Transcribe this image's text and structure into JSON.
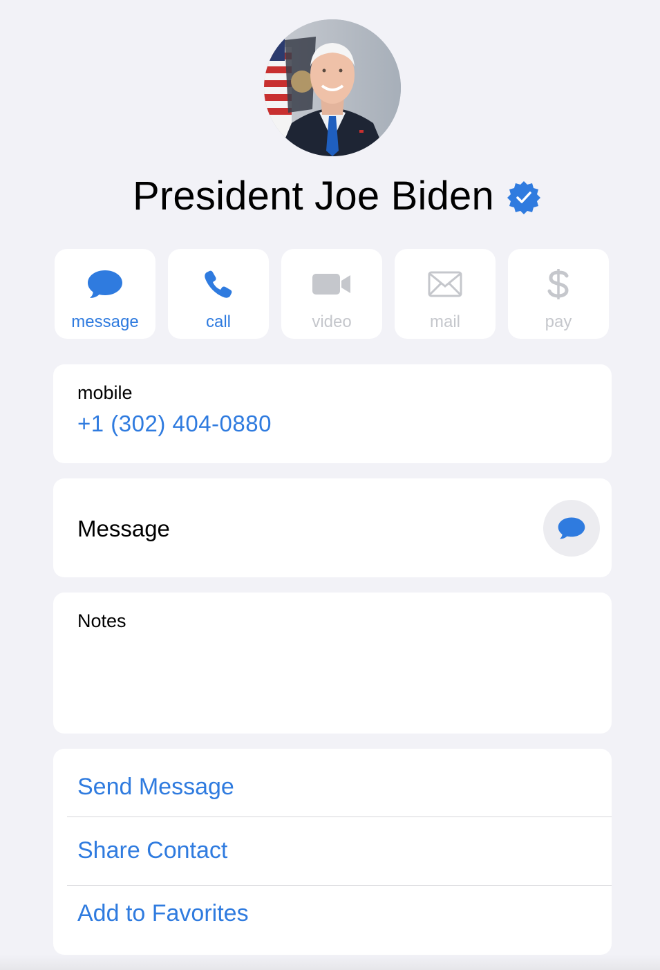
{
  "contact": {
    "name": "President Joe Biden",
    "verified": true
  },
  "actions": [
    {
      "label": "message",
      "icon": "message-bubble-icon",
      "enabled": true
    },
    {
      "label": "call",
      "icon": "phone-icon",
      "enabled": true
    },
    {
      "label": "video",
      "icon": "video-camera-icon",
      "enabled": false
    },
    {
      "label": "mail",
      "icon": "envelope-icon",
      "enabled": false
    },
    {
      "label": "pay",
      "icon": "dollar-icon",
      "enabled": false
    }
  ],
  "phone": {
    "label": "mobile",
    "number": "+1 (302) 404-0880"
  },
  "message_row": {
    "label": "Message",
    "icon": "message-bubble-icon"
  },
  "notes": {
    "label": "Notes",
    "value": ""
  },
  "links": [
    {
      "label": "Send Message"
    },
    {
      "label": "Share Contact"
    },
    {
      "label": "Add to Favorites"
    }
  ],
  "colors": {
    "accent": "#2f7bdf",
    "disabled": "#c5c7cc",
    "background": "#f2f2f7",
    "card": "#ffffff"
  }
}
